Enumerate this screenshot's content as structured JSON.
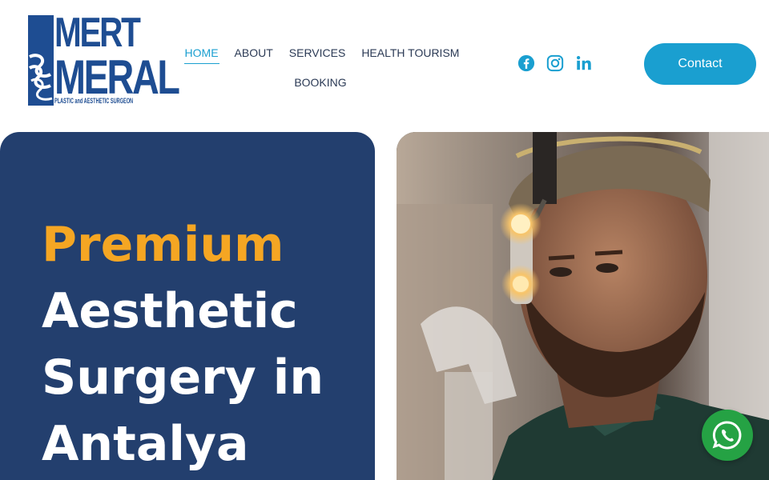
{
  "brand": {
    "line1": "MERT",
    "line2": "MERAL",
    "tagline": "PLASTIC and AESTHETIC SURGEON",
    "color": "#1e4d92"
  },
  "nav": {
    "items": [
      {
        "label": "HOME",
        "active": true
      },
      {
        "label": "ABOUT"
      },
      {
        "label": "SERVICES"
      },
      {
        "label": "HEALTH TOURISM"
      },
      {
        "label": "BOOKING"
      }
    ]
  },
  "social": {
    "icons": [
      "facebook-icon",
      "instagram-icon",
      "linkedin-icon"
    ]
  },
  "contact": {
    "label": "Contact",
    "color": "#1a9fd0"
  },
  "hero": {
    "accent_word": "Premium",
    "line2": "Aesthetic",
    "line3": "Surgery in",
    "line4": "Antalya",
    "background": "#233f6e",
    "accent_color": "#f5a623"
  },
  "photo": {
    "icon": "surgeon-photo"
  },
  "whatsapp": {
    "icon": "whatsapp-icon",
    "color": "#25a244"
  }
}
